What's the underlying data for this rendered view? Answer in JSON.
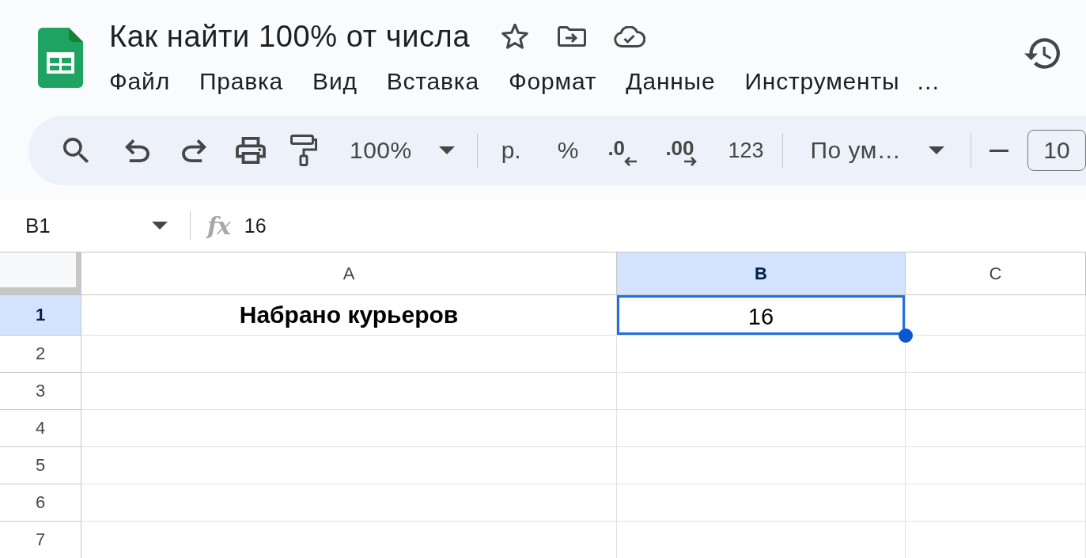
{
  "document": {
    "title": "Как найти 100% от числа",
    "menu": [
      "Файл",
      "Правка",
      "Вид",
      "Вставка",
      "Формат",
      "Данные",
      "Инструменты"
    ],
    "menu_more": "…"
  },
  "toolbar": {
    "zoom": "100%",
    "currency": "р.",
    "percent": "%",
    "decrease_decimal": ".0",
    "increase_decimal": ".00",
    "number_format": "123",
    "font": "По ум…",
    "font_size": "10"
  },
  "formula_bar": {
    "cell_ref": "B1",
    "fx": "fx",
    "value": "16"
  },
  "grid": {
    "columns": [
      {
        "label": "A",
        "selected": false
      },
      {
        "label": "B",
        "selected": true
      },
      {
        "label": "C",
        "selected": false
      }
    ],
    "rows": [
      {
        "label": "1",
        "selected": true,
        "cells": [
          {
            "text": "Набрано курьеров",
            "bold": true,
            "selected": false
          },
          {
            "text": "16",
            "bold": false,
            "selected": true
          }
        ]
      },
      {
        "label": "2",
        "selected": false
      },
      {
        "label": "3",
        "selected": false
      },
      {
        "label": "4",
        "selected": false
      },
      {
        "label": "5",
        "selected": false
      },
      {
        "label": "6",
        "selected": false
      },
      {
        "label": "7",
        "selected": false
      }
    ]
  }
}
